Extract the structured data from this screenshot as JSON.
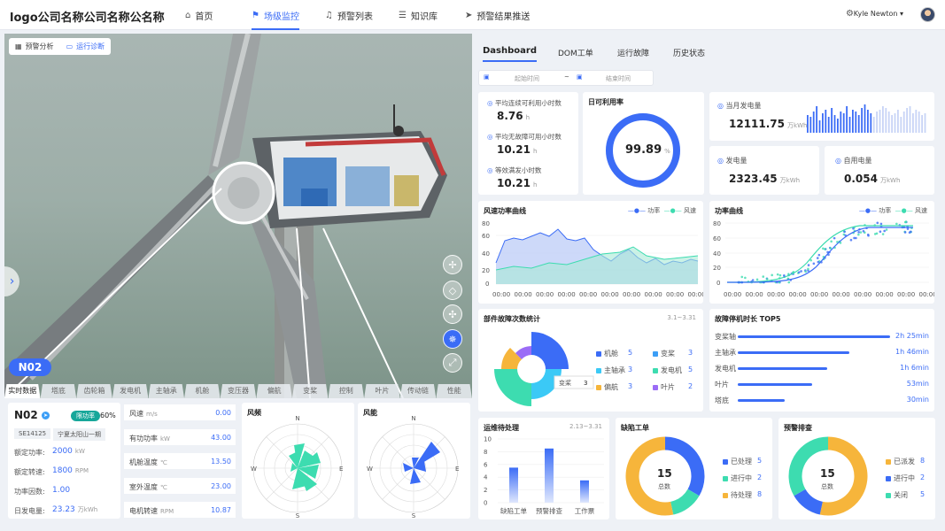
{
  "header": {
    "logo": "logo公司名称公司名称公名称",
    "nav": [
      {
        "label": "首页",
        "icon": "home-icon"
      },
      {
        "label": "场级监控",
        "icon": "monitor-icon"
      },
      {
        "label": "预警列表",
        "icon": "bell-icon"
      },
      {
        "label": "知识库",
        "icon": "database-icon"
      },
      {
        "label": "预警结果推送",
        "icon": "send-icon"
      }
    ],
    "user": "Kyle Newton"
  },
  "viewer": {
    "btn_analysis": "预警分析",
    "btn_diagnosis": "运行诊断",
    "turbine": "N02",
    "subtabs": [
      "实时数据",
      "塔底",
      "齿轮箱",
      "发电机",
      "主轴承",
      "机舱",
      "变压器",
      "偏航",
      "变桨",
      "控制",
      "叶片",
      "传动链",
      "性能"
    ]
  },
  "turbine_info": {
    "name": "N02",
    "badge": "限功率",
    "percent": "60%",
    "tag1": "SE14125",
    "tag2": "宁夏太阳山一期",
    "rows": [
      {
        "label": "额定功率:",
        "value": "2000",
        "unit": "kW"
      },
      {
        "label": "额定转速:",
        "value": "1800",
        "unit": "RPM"
      },
      {
        "label": "功率因数:",
        "value": "1.00",
        "unit": ""
      },
      {
        "label": "日发电量:",
        "value": "23.23",
        "unit": "万kWh"
      }
    ]
  },
  "params": [
    {
      "label": "风速",
      "unit": "m/s",
      "value": "0.00"
    },
    {
      "label": "有功功率",
      "unit": "kW",
      "value": "43.00"
    },
    {
      "label": "机舱温度",
      "unit": "℃",
      "value": "13.50"
    },
    {
      "label": "室外温度",
      "unit": "℃",
      "value": "23.00"
    },
    {
      "label": "电机转速",
      "unit": "RPM",
      "value": "10.87"
    }
  ],
  "rose1": {
    "title": "风频",
    "n": "N",
    "e": "E",
    "s": "S",
    "w": "W"
  },
  "rose2": {
    "title": "风能",
    "n": "N",
    "e": "E",
    "s": "S",
    "w": "W"
  },
  "dash_tabs": [
    "Dashboard",
    "DOM工单",
    "运行故障",
    "历史状态"
  ],
  "date": {
    "start": "起始时间",
    "sep": "~",
    "end": "结束时间"
  },
  "hours": [
    {
      "label": "平均连续可利用小时数",
      "value": "8.76",
      "unit": "h"
    },
    {
      "label": "平均无故障可用小时数",
      "value": "10.21",
      "unit": "h"
    },
    {
      "label": "等效满发小时数",
      "value": "10.21",
      "unit": "h"
    }
  ],
  "daily_rate": {
    "title": "日可利用率",
    "value": "99.89",
    "unit": "%",
    "fraction": 0.9989
  },
  "month_gen": {
    "label": "当月发电量",
    "value": "12111.75",
    "unit": "万kWh"
  },
  "gen": {
    "label": "发电量",
    "value": "2323.45",
    "unit": "万kWh"
  },
  "self_use": {
    "label": "自用电量",
    "value": "0.054",
    "unit": "万kWh"
  },
  "chart_wind_power": {
    "title": "风速功率曲线",
    "legend": [
      "功率",
      "风速"
    ],
    "yticks": [
      "60",
      "40",
      "20",
      "0",
      "80",
      "60",
      "40",
      "20",
      "0"
    ],
    "xticks": [
      "00:00",
      "00:00",
      "00:00",
      "00:00",
      "00:00",
      "00:00",
      "00:00",
      "00:00",
      "00:00",
      "00:00"
    ]
  },
  "chart_power_curve": {
    "title": "功率曲线",
    "legend": [
      "功率",
      "风速"
    ],
    "yticks": [
      "80",
      "60",
      "40",
      "20",
      "0"
    ],
    "xticks": [
      "00:00",
      "00:00",
      "00:00",
      "00:00",
      "00:00",
      "00:00",
      "00:00",
      "00:00",
      "00:00",
      "00:00"
    ]
  },
  "parts_fault": {
    "title": "部件故障次数统计",
    "date": "3.1~3.31",
    "tooltip_label": "变桨",
    "tooltip_value": "3",
    "items": [
      {
        "label": "机舱",
        "value": "5",
        "color": "#3b6cf6"
      },
      {
        "label": "变桨",
        "value": "3",
        "color": "#3b9ef6"
      },
      {
        "label": "主轴承",
        "value": "3",
        "color": "#3bc9f6"
      },
      {
        "label": "发电机",
        "value": "5",
        "color": "#3ddcb0"
      },
      {
        "label": "偏航",
        "value": "3",
        "color": "#f6b53b"
      },
      {
        "label": "叶片",
        "value": "2",
        "color": "#9b6cf6"
      }
    ]
  },
  "stop_top5": {
    "title": "故障停机时长 TOP5",
    "rows": [
      {
        "label": "变桨轴",
        "value": "2h 25min",
        "pct": 1.0
      },
      {
        "label": "主轴承",
        "value": "1h 46min",
        "pct": 0.73
      },
      {
        "label": "发电机",
        "value": "1h 6min",
        "pct": 0.59
      },
      {
        "label": "叶片",
        "value": "53min",
        "pct": 0.49
      },
      {
        "label": "塔底",
        "value": "30min",
        "pct": 0.31
      }
    ]
  },
  "ops": {
    "title": "运维待处理",
    "date": "2.13~3.31",
    "yticks": [
      "10",
      "8",
      "6",
      "4",
      "2",
      "0"
    ],
    "categories": [
      "缺陷工单",
      "预警排查",
      "工作票"
    ],
    "values": [
      5.5,
      8.5,
      3.5
    ]
  },
  "defect": {
    "title": "缺陷工单",
    "total": "15",
    "total_label": "总数",
    "items": [
      {
        "label": "已处理",
        "value": "5",
        "color": "#3b6cf6"
      },
      {
        "label": "进行中",
        "value": "2",
        "color": "#3ddcb0"
      },
      {
        "label": "待处理",
        "value": "8",
        "color": "#f6b53b"
      }
    ]
  },
  "warn": {
    "title": "预警排查",
    "total": "15",
    "total_label": "总数",
    "items": [
      {
        "label": "已派发",
        "value": "8",
        "color": "#f6b53b"
      },
      {
        "label": "进行中",
        "value": "2",
        "color": "#3b6cf6"
      },
      {
        "label": "关闭",
        "value": "5",
        "color": "#3ddcb0"
      }
    ]
  }
}
